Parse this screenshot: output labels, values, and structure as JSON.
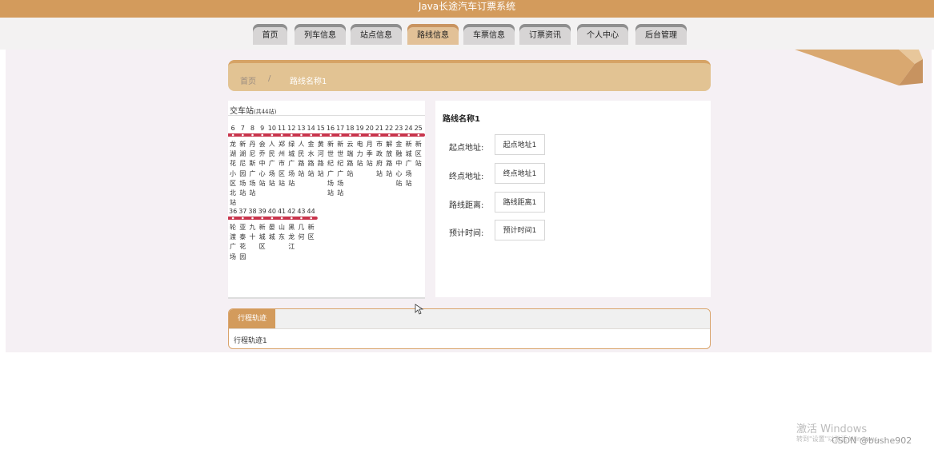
{
  "app": {
    "title": "Java长途汽车订票系统"
  },
  "nav": {
    "items": [
      {
        "label": "首页",
        "active": false
      },
      {
        "label": "列车信息",
        "active": false
      },
      {
        "label": "站点信息",
        "active": false
      },
      {
        "label": "路线信息",
        "active": true
      },
      {
        "label": "车票信息",
        "active": false
      },
      {
        "label": "订票资讯",
        "active": false
      },
      {
        "label": "个人中心",
        "active": false
      },
      {
        "label": "后台管理",
        "active": false
      }
    ]
  },
  "breadcrumb": {
    "home": "首页",
    "separator": "/",
    "current": "路线名称1"
  },
  "route_map": {
    "title": "交车站",
    "count": "(共44站)",
    "line_color": "#c8344c",
    "row1": {
      "numbers": [
        "6",
        "7",
        "8",
        "9",
        "10",
        "11",
        "12",
        "13",
        "14",
        "15",
        "16",
        "17",
        "18",
        "19",
        "20",
        "21",
        "22",
        "23",
        "24",
        "25"
      ],
      "stations": [
        "龙湖花小区北站",
        "新湖尼园场站",
        "丹尼斯广场站",
        "会乔中心站",
        "人民广场站",
        "郑州市区站",
        "绿城广场站",
        "人民路站",
        "金水路站",
        "黄河路站",
        "新世纪广场站",
        "新世纪广场站",
        "云端路站",
        "电力站",
        "月季站",
        "市政府站",
        "解放路站",
        "金融中心站",
        "新城广场站",
        "新区站"
      ]
    },
    "row2": {
      "numbers": [
        "36",
        "37",
        "38",
        "39",
        "40",
        "41",
        "42",
        "43",
        "44"
      ],
      "stations": [
        "轮渡广场",
        "亚泰花园",
        "九十",
        "新城区",
        "晏城",
        "山东",
        "黑龙江",
        "几何",
        "新区"
      ]
    }
  },
  "detail": {
    "name": "路线名称1",
    "fields": [
      {
        "label": "起点地址:",
        "value": "起点地址1"
      },
      {
        "label": "终点地址:",
        "value": "终点地址1"
      },
      {
        "label": "路线距离:",
        "value": "路线距离1"
      },
      {
        "label": "预计时间:",
        "value": "预计时间1"
      }
    ]
  },
  "tabs": {
    "active": "行程轨迹",
    "content": "行程轨迹1"
  },
  "watermark": {
    "line1": "激活 Windows",
    "line2": "转到\"设置\"以激活 Windows。",
    "credit": "CSDN @bushe902"
  },
  "colors": {
    "brand": "#d39b5c",
    "active_tab": "#e2c197",
    "route_line": "#c8344c"
  }
}
